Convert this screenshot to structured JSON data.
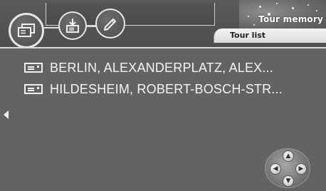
{
  "banner": {
    "title": "Tour memory"
  },
  "tab": {
    "label": "Tour list"
  },
  "toolbar": {
    "buttons": [
      {
        "name": "tour-list-button",
        "icon": "list-cards-icon",
        "active": true
      },
      {
        "name": "import-button",
        "icon": "import-tray-icon",
        "active": false
      },
      {
        "name": "edit-button",
        "icon": "pencil-icon",
        "active": false
      }
    ]
  },
  "tours": [
    {
      "label": "BERLIN, ALEXANDERPLATZ, ALEX...",
      "icon": "destination-card-icon"
    },
    {
      "label": "HILDESHEIM, ROBERT-BOSCH-STR...",
      "icon": "destination-card-icon"
    }
  ],
  "navigation": {
    "left_arrow": "scroll-left-arrow-icon",
    "dpad": {
      "up": "▲",
      "down": "▼",
      "left": "◀",
      "right": "▶"
    }
  },
  "colors": {
    "background": "#636363",
    "text": "#f4f4f4",
    "tab": "#e8e8e8"
  }
}
